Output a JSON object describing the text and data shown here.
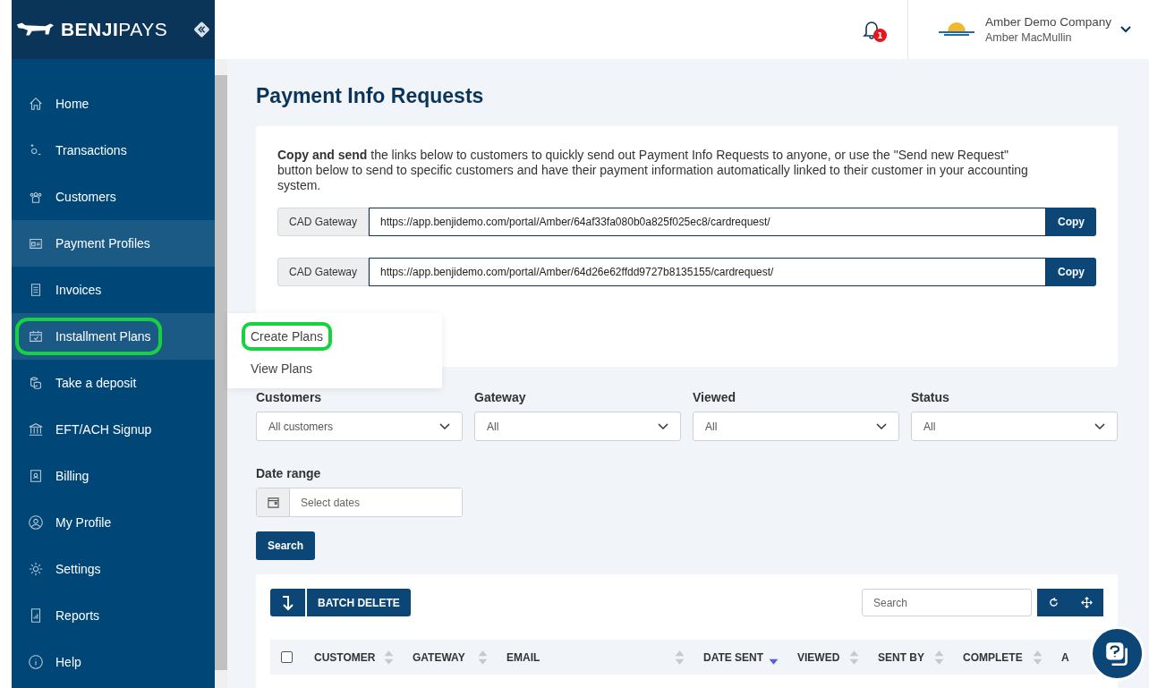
{
  "brand": {
    "logo": "**BENJI**PAYS"
  },
  "header": {
    "notifications": "1",
    "company": "Amber Demo Company",
    "user": "Amber MacMullin"
  },
  "sidebar": {
    "items": [
      {
        "label": "Home",
        "kind": "home",
        "selected": false,
        "highlighted": false
      },
      {
        "label": "Transactions",
        "kind": "transactions",
        "selected": false,
        "highlighted": false
      },
      {
        "label": "Customers",
        "kind": "customers",
        "selected": false,
        "highlighted": false
      },
      {
        "label": "Payment Profiles",
        "kind": "profiles",
        "selected": true,
        "highlighted": false
      },
      {
        "label": "Invoices",
        "kind": "invoices",
        "selected": false,
        "highlighted": false
      },
      {
        "label": "Installment Plans",
        "kind": "plans",
        "selected": true,
        "highlighted": true
      },
      {
        "label": "Take a deposit",
        "kind": "deposit",
        "selected": false,
        "highlighted": false
      },
      {
        "label": "EFT/ACH Signup",
        "kind": "bank",
        "selected": false,
        "highlighted": false
      },
      {
        "label": "Billing",
        "kind": "billing",
        "selected": false,
        "highlighted": false
      },
      {
        "label": "My Profile",
        "kind": "profile",
        "selected": false,
        "highlighted": false
      },
      {
        "label": "Settings",
        "kind": "settings",
        "selected": false,
        "highlighted": false
      },
      {
        "label": "Reports",
        "kind": "reports",
        "selected": false,
        "highlighted": false
      },
      {
        "label": "Help",
        "kind": "help",
        "selected": false,
        "highlighted": false
      }
    ]
  },
  "submenu": {
    "items": [
      {
        "label": "Create Plans",
        "highlighted": true
      },
      {
        "label": "View Plans",
        "highlighted": false
      }
    ]
  },
  "page": {
    "title": "Payment Info Requests"
  },
  "intro": {
    "text": "**Copy and send** the links below to customers to quickly send out Payment Info Requests to anyone, or use the \"Send new Request\" button below to send to specific customers and have their payment information automatically linked to their customer in your accounting system."
  },
  "links": [
    {
      "gateway": "CAD Gateway",
      "url": "https://app.benjidemo.com/portal/Amber/64af33fa080b0a825f025ec8/cardrequest/",
      "button": "Copy"
    },
    {
      "gateway": "CAD Gateway",
      "url": "https://app.benjidemo.com/portal/Amber/64d26e62ffdd9727b8135155/cardrequest/",
      "button": "Copy"
    }
  ],
  "filters": [
    {
      "label": "Customers",
      "value": "All customers"
    },
    {
      "label": "Gateway",
      "value": "All"
    },
    {
      "label": "Viewed",
      "value": "All"
    },
    {
      "label": "Status",
      "value": "All"
    }
  ],
  "date_range": {
    "label": "Date range",
    "placeholder": "Select dates"
  },
  "search_button": "Search",
  "table": {
    "batch_delete": "BATCH DELETE",
    "search_placeholder": "Search",
    "select_all": {
      "checked": false
    },
    "columns": [
      {
        "label": "CUSTOMER",
        "sorted": false
      },
      {
        "label": "GATEWAY",
        "sorted": false
      },
      {
        "label": "EMAIL",
        "sorted": false
      },
      {
        "label": "DATE SENT",
        "sorted": true
      },
      {
        "label": "VIEWED",
        "sorted": false
      },
      {
        "label": "SENT BY",
        "sorted": false
      },
      {
        "label": "COMPLETE",
        "sorted": false
      },
      {
        "label": "A"
      }
    ]
  }
}
